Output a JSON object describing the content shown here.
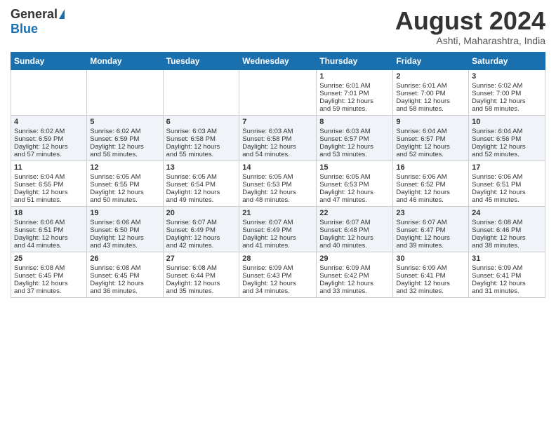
{
  "header": {
    "logo_general": "General",
    "logo_blue": "Blue",
    "month_title": "August 2024",
    "location": "Ashti, Maharashtra, India"
  },
  "days_of_week": [
    "Sunday",
    "Monday",
    "Tuesday",
    "Wednesday",
    "Thursday",
    "Friday",
    "Saturday"
  ],
  "weeks": [
    [
      {
        "day": "",
        "info": ""
      },
      {
        "day": "",
        "info": ""
      },
      {
        "day": "",
        "info": ""
      },
      {
        "day": "",
        "info": ""
      },
      {
        "day": "1",
        "info": "Sunrise: 6:01 AM\nSunset: 7:01 PM\nDaylight: 12 hours\nand 59 minutes."
      },
      {
        "day": "2",
        "info": "Sunrise: 6:01 AM\nSunset: 7:00 PM\nDaylight: 12 hours\nand 58 minutes."
      },
      {
        "day": "3",
        "info": "Sunrise: 6:02 AM\nSunset: 7:00 PM\nDaylight: 12 hours\nand 58 minutes."
      }
    ],
    [
      {
        "day": "4",
        "info": "Sunrise: 6:02 AM\nSunset: 6:59 PM\nDaylight: 12 hours\nand 57 minutes."
      },
      {
        "day": "5",
        "info": "Sunrise: 6:02 AM\nSunset: 6:59 PM\nDaylight: 12 hours\nand 56 minutes."
      },
      {
        "day": "6",
        "info": "Sunrise: 6:03 AM\nSunset: 6:58 PM\nDaylight: 12 hours\nand 55 minutes."
      },
      {
        "day": "7",
        "info": "Sunrise: 6:03 AM\nSunset: 6:58 PM\nDaylight: 12 hours\nand 54 minutes."
      },
      {
        "day": "8",
        "info": "Sunrise: 6:03 AM\nSunset: 6:57 PM\nDaylight: 12 hours\nand 53 minutes."
      },
      {
        "day": "9",
        "info": "Sunrise: 6:04 AM\nSunset: 6:57 PM\nDaylight: 12 hours\nand 52 minutes."
      },
      {
        "day": "10",
        "info": "Sunrise: 6:04 AM\nSunset: 6:56 PM\nDaylight: 12 hours\nand 52 minutes."
      }
    ],
    [
      {
        "day": "11",
        "info": "Sunrise: 6:04 AM\nSunset: 6:55 PM\nDaylight: 12 hours\nand 51 minutes."
      },
      {
        "day": "12",
        "info": "Sunrise: 6:05 AM\nSunset: 6:55 PM\nDaylight: 12 hours\nand 50 minutes."
      },
      {
        "day": "13",
        "info": "Sunrise: 6:05 AM\nSunset: 6:54 PM\nDaylight: 12 hours\nand 49 minutes."
      },
      {
        "day": "14",
        "info": "Sunrise: 6:05 AM\nSunset: 6:53 PM\nDaylight: 12 hours\nand 48 minutes."
      },
      {
        "day": "15",
        "info": "Sunrise: 6:05 AM\nSunset: 6:53 PM\nDaylight: 12 hours\nand 47 minutes."
      },
      {
        "day": "16",
        "info": "Sunrise: 6:06 AM\nSunset: 6:52 PM\nDaylight: 12 hours\nand 46 minutes."
      },
      {
        "day": "17",
        "info": "Sunrise: 6:06 AM\nSunset: 6:51 PM\nDaylight: 12 hours\nand 45 minutes."
      }
    ],
    [
      {
        "day": "18",
        "info": "Sunrise: 6:06 AM\nSunset: 6:51 PM\nDaylight: 12 hours\nand 44 minutes."
      },
      {
        "day": "19",
        "info": "Sunrise: 6:06 AM\nSunset: 6:50 PM\nDaylight: 12 hours\nand 43 minutes."
      },
      {
        "day": "20",
        "info": "Sunrise: 6:07 AM\nSunset: 6:49 PM\nDaylight: 12 hours\nand 42 minutes."
      },
      {
        "day": "21",
        "info": "Sunrise: 6:07 AM\nSunset: 6:49 PM\nDaylight: 12 hours\nand 41 minutes."
      },
      {
        "day": "22",
        "info": "Sunrise: 6:07 AM\nSunset: 6:48 PM\nDaylight: 12 hours\nand 40 minutes."
      },
      {
        "day": "23",
        "info": "Sunrise: 6:07 AM\nSunset: 6:47 PM\nDaylight: 12 hours\nand 39 minutes."
      },
      {
        "day": "24",
        "info": "Sunrise: 6:08 AM\nSunset: 6:46 PM\nDaylight: 12 hours\nand 38 minutes."
      }
    ],
    [
      {
        "day": "25",
        "info": "Sunrise: 6:08 AM\nSunset: 6:45 PM\nDaylight: 12 hours\nand 37 minutes."
      },
      {
        "day": "26",
        "info": "Sunrise: 6:08 AM\nSunset: 6:45 PM\nDaylight: 12 hours\nand 36 minutes."
      },
      {
        "day": "27",
        "info": "Sunrise: 6:08 AM\nSunset: 6:44 PM\nDaylight: 12 hours\nand 35 minutes."
      },
      {
        "day": "28",
        "info": "Sunrise: 6:09 AM\nSunset: 6:43 PM\nDaylight: 12 hours\nand 34 minutes."
      },
      {
        "day": "29",
        "info": "Sunrise: 6:09 AM\nSunset: 6:42 PM\nDaylight: 12 hours\nand 33 minutes."
      },
      {
        "day": "30",
        "info": "Sunrise: 6:09 AM\nSunset: 6:41 PM\nDaylight: 12 hours\nand 32 minutes."
      },
      {
        "day": "31",
        "info": "Sunrise: 6:09 AM\nSunset: 6:41 PM\nDaylight: 12 hours\nand 31 minutes."
      }
    ]
  ]
}
